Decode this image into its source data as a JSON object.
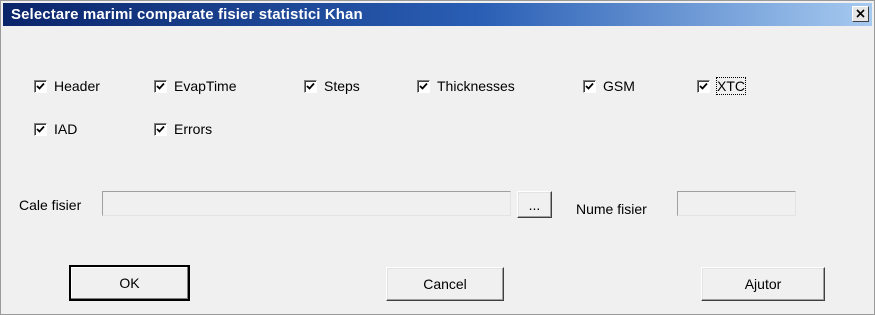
{
  "window": {
    "title": "Selectare marimi comparate fisier statistici Khan"
  },
  "checkboxes": [
    {
      "label": "Header",
      "checked": true
    },
    {
      "label": "EvapTime",
      "checked": true
    },
    {
      "label": "Steps",
      "checked": true
    },
    {
      "label": "Thicknesses",
      "checked": true
    },
    {
      "label": "GSM",
      "checked": true
    },
    {
      "label": "XTC",
      "checked": true,
      "focused": true
    },
    {
      "label": "IAD",
      "checked": true
    },
    {
      "label": "Errors",
      "checked": true
    }
  ],
  "path": {
    "label": "Cale fisier",
    "value": "",
    "browse_label": "..."
  },
  "filename": {
    "label": "Nume fisier",
    "value": ""
  },
  "buttons": {
    "ok": "OK",
    "cancel": "Cancel",
    "help": "Ajutor"
  },
  "colors": {
    "titlebar_start": "#0a246a",
    "titlebar_end": "#a6caf0",
    "dialog_bg": "#f0f0f0"
  }
}
